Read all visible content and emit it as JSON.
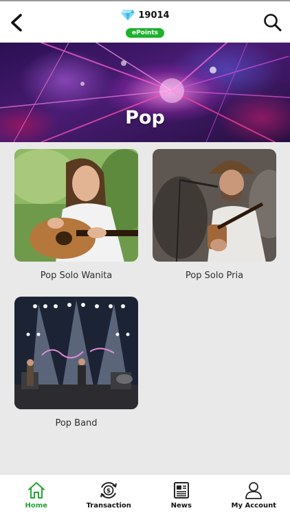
{
  "header": {
    "points_value": "19014",
    "points_label": "ePoints",
    "icons": {
      "back": "back-arrow-icon",
      "search": "search-icon",
      "points": "diamond-icon"
    }
  },
  "hero": {
    "title": "Pop"
  },
  "categories": [
    {
      "label": "Pop Solo Wanita",
      "image": "woman-playing-acoustic-guitar"
    },
    {
      "label": "Pop Solo Pria",
      "image": "man-singing-with-guitar"
    },
    {
      "label": "Pop Band",
      "image": "band-on-stage"
    }
  ],
  "bottom_nav": [
    {
      "label": "Home",
      "icon": "home-icon",
      "active": true
    },
    {
      "label": "Transaction",
      "icon": "transaction-icon",
      "active": false
    },
    {
      "label": "News",
      "icon": "news-icon",
      "active": false
    },
    {
      "label": "My Account",
      "icon": "account-icon",
      "active": false
    }
  ],
  "colors": {
    "accent_green": "#21a532",
    "badge_green": "#1fb12e",
    "background": "#e9e9e9"
  }
}
